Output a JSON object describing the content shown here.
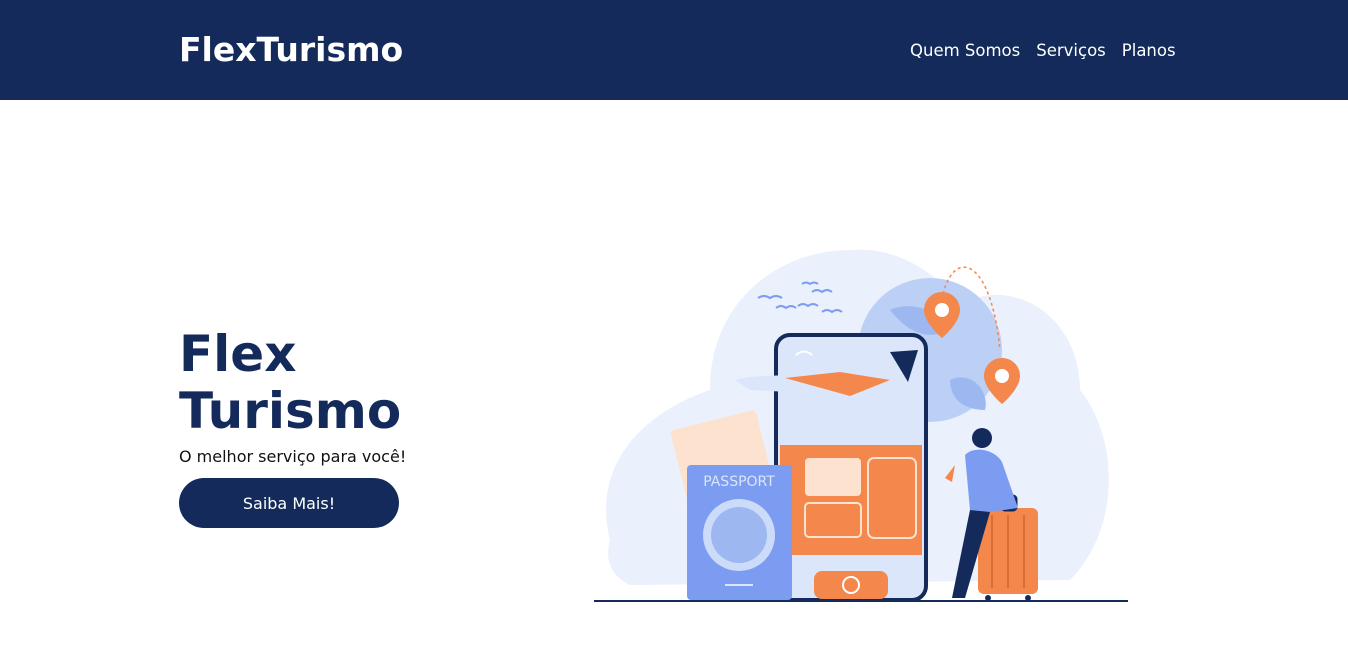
{
  "navbar": {
    "brand": "FlexTurismo",
    "links": [
      "Quem Somos",
      "Serviços",
      "Planos"
    ]
  },
  "hero": {
    "title": "Flex Turismo",
    "subtitle": "O melhor serviço para você!",
    "cta_label": "Saiba Mais!"
  },
  "illustration": {
    "passport_text": "PASSPORT",
    "icons": [
      "passport-icon",
      "smartphone-icon",
      "airplane-icon",
      "location-pin-icon",
      "suitcase-icon",
      "traveler-figure",
      "birds-icon",
      "globe-icon"
    ]
  },
  "colors": {
    "navbar_bg": "#132a5a",
    "primary": "#132a5a",
    "accent_orange": "#f4874b",
    "accent_blue": "#7b9cf0"
  }
}
